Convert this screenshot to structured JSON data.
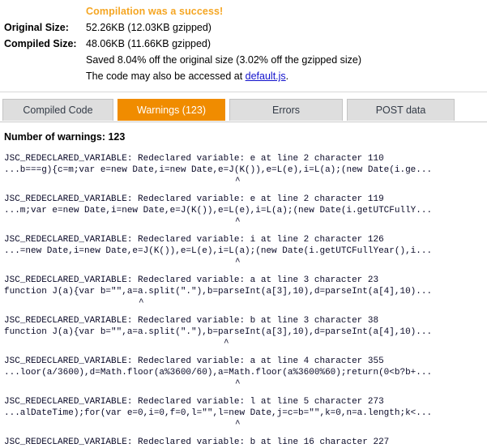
{
  "summary": {
    "status_text": "Compilation was a success!",
    "status_color": "#f5a623",
    "rows": [
      {
        "label": "Original Size:",
        "value": "52.26KB (12.03KB gzipped)"
      },
      {
        "label": "Compiled Size:",
        "value": "48.06KB (11.66KB gzipped)"
      }
    ],
    "saved_text": "Saved 8.04% off the original size (3.02% off the gzipped size)",
    "access_prefix": "The code may also be accessed at ",
    "access_link": "default.js",
    "access_suffix": "."
  },
  "tabs": [
    {
      "label": "Compiled Code",
      "active": false
    },
    {
      "label": "Warnings (123)",
      "active": true
    },
    {
      "label": "Errors",
      "active": false
    },
    {
      "label": "POST data",
      "active": false
    }
  ],
  "warnings_panel": {
    "count_label": "Number of warnings: 123",
    "entries": [
      {
        "message": "JSC_REDECLARED_VARIABLE: Redeclared variable: e at line 2 character 110",
        "source": "...b===g){c=m;var e=new Date,i=new Date,e=J(K()),e=L(e),i=L(a);(new Date(i.ge...",
        "caret_col": 43
      },
      {
        "message": "JSC_REDECLARED_VARIABLE: Redeclared variable: e at line 2 character 119",
        "source": "...m;var e=new Date,i=new Date,e=J(K()),e=L(e),i=L(a);(new Date(i.getUTCFullY...",
        "caret_col": 43
      },
      {
        "message": "JSC_REDECLARED_VARIABLE: Redeclared variable: i at line 2 character 126",
        "source": "...=new Date,i=new Date,e=J(K()),e=L(e),i=L(a);(new Date(i.getUTCFullYear(),i...",
        "caret_col": 43
      },
      {
        "message": "JSC_REDECLARED_VARIABLE: Redeclared variable: a at line 3 character 23",
        "source": "function J(a){var b=\"\",a=a.split(\".\"),b=parseInt(a[3],10),d=parseInt(a[4],10)...",
        "caret_col": 25
      },
      {
        "message": "JSC_REDECLARED_VARIABLE: Redeclared variable: b at line 3 character 38",
        "source": "function J(a){var b=\"\",a=a.split(\".\"),b=parseInt(a[3],10),d=parseInt(a[4],10)...",
        "caret_col": 41
      },
      {
        "message": "JSC_REDECLARED_VARIABLE: Redeclared variable: a at line 4 character 355",
        "source": "...loor(a/3600),d=Math.floor(a%3600/60),a=Math.floor(a%3600%60);return(0<b?b+...",
        "caret_col": 43
      },
      {
        "message": "JSC_REDECLARED_VARIABLE: Redeclared variable: l at line 5 character 273",
        "source": "...alDateTime);for(var e=0,i=0,f=0,l=\"\",l=new Date,j=c=b=\"\",k=0,n=a.length;k<...",
        "caret_col": 43
      },
      {
        "message": "JSC_REDECLARED_VARIABLE: Redeclared variable: b at line 16 character 227",
        "source": "",
        "caret_col": -1
      }
    ]
  }
}
